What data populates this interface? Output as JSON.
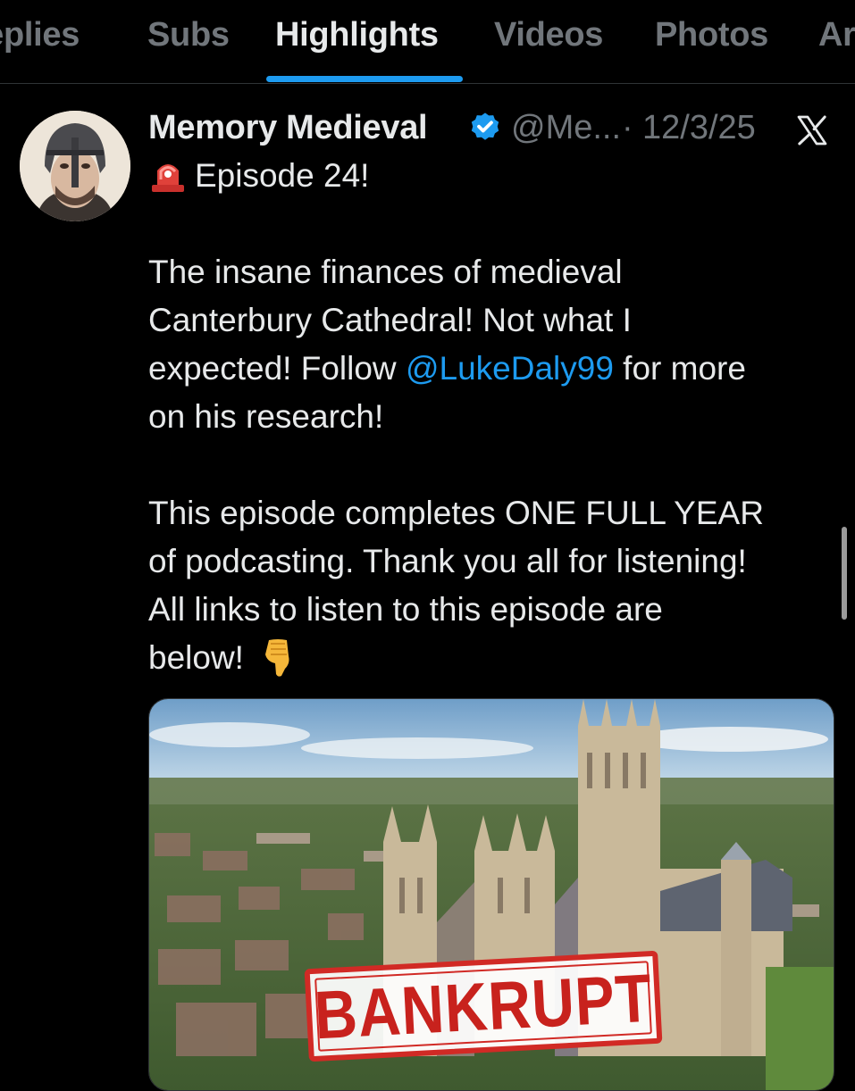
{
  "tabs": [
    {
      "label": "Replies",
      "active": false
    },
    {
      "label": "Subs",
      "active": false
    },
    {
      "label": "Highlights",
      "active": true
    },
    {
      "label": "Videos",
      "active": false
    },
    {
      "label": "Photos",
      "active": false
    },
    {
      "label": "Articles",
      "active": false
    }
  ],
  "post": {
    "author_name": "Memory Medieval",
    "verified_icon": "verified-badge-icon",
    "handle": "@Me...",
    "separator": "·",
    "date": "12/3/25",
    "source_icon": "x-logo-icon",
    "episode_emoji": "police-siren-icon",
    "episode_line": "Episode 24!",
    "paragraph1": {
      "line1": "The insane finances of medieval",
      "line2": "Canterbury Cathedral! Not what I",
      "line3_before": "expected! Follow ",
      "mention": "@LukeDaly99",
      "line3_after": " for more",
      "line4": "on his research!"
    },
    "paragraph2": {
      "line1": "This episode completes ONE FULL YEAR",
      "line2": "of podcasting. Thank you all for listening!",
      "line3": "All links to listen to this episode are",
      "line4": "below!",
      "pointer_emoji": "pointing-down-hand-icon"
    },
    "media": {
      "stamp_text": "BANKRUPT"
    }
  },
  "colors": {
    "background": "#000000",
    "text_primary": "#e7e9ea",
    "text_secondary": "#71767b",
    "accent": "#1d9bf0",
    "stamp_red": "#d12a25"
  }
}
